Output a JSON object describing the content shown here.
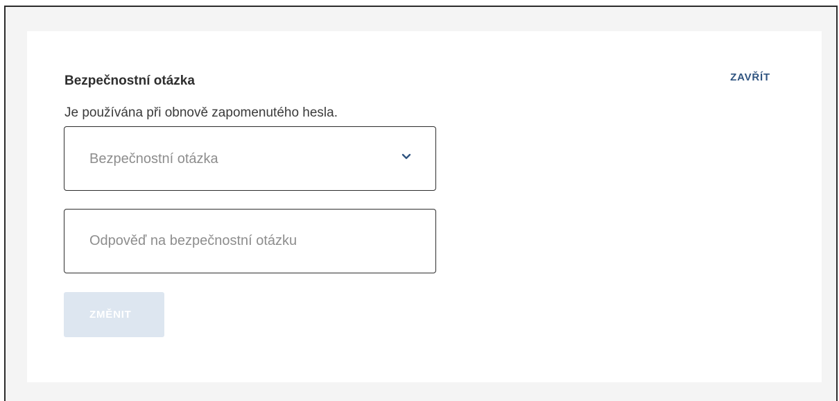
{
  "security_question_panel": {
    "title": "Bezpečnostní otázka",
    "close_label": "ZAVŘÍT",
    "description": "Je používána při obnově zapomenutého hesla.",
    "question_select": {
      "placeholder": "Bezpečnostní otázka",
      "selected_value": "",
      "icon": "chevron-down-icon"
    },
    "answer_input": {
      "placeholder": "Odpověď na bezpečnostní otázku",
      "value": ""
    },
    "submit_label": "ZMĚNIT",
    "submit_disabled": true
  },
  "colors": {
    "accent": "#2f5480",
    "button_disabled_bg": "#dde6f0",
    "field_border": "#2d2d2d",
    "page_background": "#f4f4f4",
    "card_background": "#ffffff"
  }
}
